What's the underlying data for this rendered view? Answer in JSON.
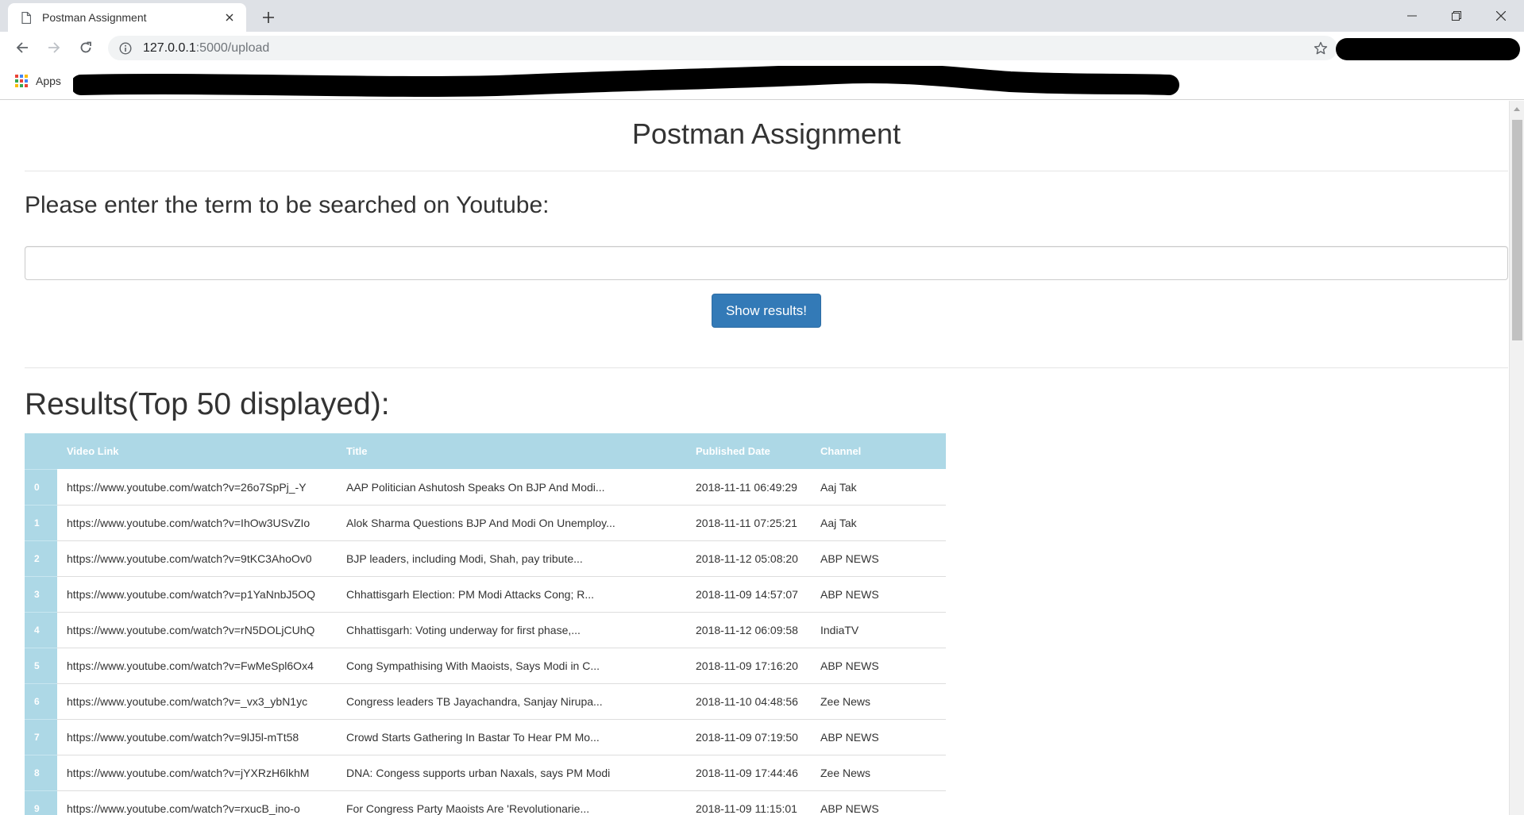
{
  "browser": {
    "tab_title": "Postman Assignment",
    "url_host": "127.0.0.1",
    "url_path": ":5000/upload",
    "bookmarks_apps_label": "Apps"
  },
  "page": {
    "title": "Postman Assignment",
    "prompt": "Please enter the term to be searched on Youtube:",
    "search_value": "",
    "button_label": "Show results!",
    "results_title": "Results(Top 50 displayed):",
    "accent_color": "#337ab7",
    "table_header_color": "#add8e6"
  },
  "table": {
    "headers": [
      "",
      "Video Link",
      "Title",
      "Published Date",
      "Channel"
    ],
    "rows": [
      {
        "index": "0",
        "link": "https://www.youtube.com/watch?v=26o7SpPj_-Y",
        "title": "AAP Politician Ashutosh Speaks On BJP And Modi...",
        "date": "2018-11-11 06:49:29",
        "channel": "Aaj Tak"
      },
      {
        "index": "1",
        "link": "https://www.youtube.com/watch?v=IhOw3USvZIo",
        "title": "Alok Sharma Questions BJP And Modi On Unemploy...",
        "date": "2018-11-11 07:25:21",
        "channel": "Aaj Tak"
      },
      {
        "index": "2",
        "link": "https://www.youtube.com/watch?v=9tKC3AhoOv0",
        "title": "BJP leaders, including Modi, Shah, pay tribute...",
        "date": "2018-11-12 05:08:20",
        "channel": "ABP NEWS"
      },
      {
        "index": "3",
        "link": "https://www.youtube.com/watch?v=p1YaNnbJ5OQ",
        "title": "Chhattisgarh Election: PM Modi Attacks Cong; R...",
        "date": "2018-11-09 14:57:07",
        "channel": "ABP NEWS"
      },
      {
        "index": "4",
        "link": "https://www.youtube.com/watch?v=rN5DOLjCUhQ",
        "title": "Chhattisgarh: Voting underway for first phase,...",
        "date": "2018-11-12 06:09:58",
        "channel": "IndiaTV"
      },
      {
        "index": "5",
        "link": "https://www.youtube.com/watch?v=FwMeSpl6Ox4",
        "title": "Cong Sympathising With Maoists, Says Modi in C...",
        "date": "2018-11-09 17:16:20",
        "channel": "ABP NEWS"
      },
      {
        "index": "6",
        "link": "https://www.youtube.com/watch?v=_vx3_ybN1yc",
        "title": "Congress leaders TB Jayachandra, Sanjay Nirupa...",
        "date": "2018-11-10 04:48:56",
        "channel": "Zee News"
      },
      {
        "index": "7",
        "link": "https://www.youtube.com/watch?v=9lJ5l-mTt58",
        "title": "Crowd Starts Gathering In Bastar To Hear PM Mo...",
        "date": "2018-11-09 07:19:50",
        "channel": "ABP NEWS"
      },
      {
        "index": "8",
        "link": "https://www.youtube.com/watch?v=jYXRzH6lkhM",
        "title": "DNA: Congess supports urban Naxals, says PM Modi",
        "date": "2018-11-09 17:44:46",
        "channel": "Zee News"
      },
      {
        "index": "9",
        "link": "https://www.youtube.com/watch?v=rxucB_ino-o",
        "title": "For Congress Party Maoists Are 'Revolutionarie...",
        "date": "2018-11-09 11:15:01",
        "channel": "ABP NEWS"
      }
    ]
  }
}
